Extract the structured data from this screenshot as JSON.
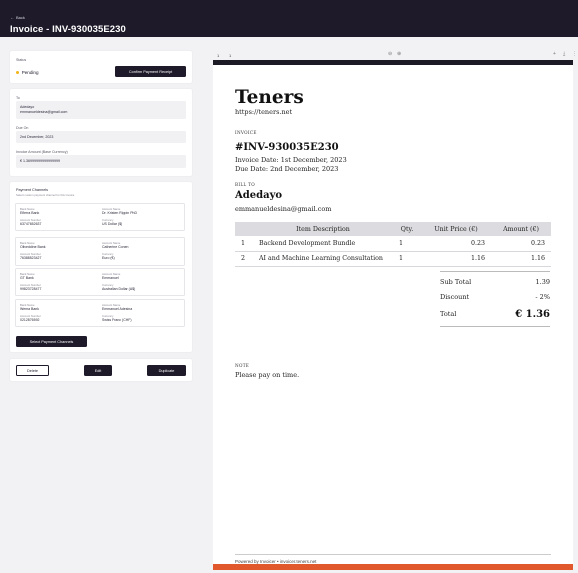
{
  "header": {
    "back_label": "Back",
    "title": "Invoice - INV-930035E230"
  },
  "status_card": {
    "label": "Status",
    "status": "Pending",
    "status_color": "#f2b517",
    "confirm_button": "Confirm Payment Receipt"
  },
  "details_card": {
    "to_label": "To",
    "to_name": "Adedayo",
    "to_email": "emmanueldesina@gmail.com",
    "due_label": "Due On",
    "due_value": "2nd December, 2023",
    "amount_label": "Invoice Amount (Base Currency)",
    "amount_value": "€ 1.36999999999999999"
  },
  "payment_channels": {
    "title": "Payment Channels",
    "subtitle": "Select custom payment channel for this invoice",
    "items": [
      {
        "bank_label": "Bank Name",
        "bank": "Eflerra Bank",
        "account_name_label": "Account Name",
        "account_name": "Dr. Kristen Rippin PhD",
        "account_number_label": "Account Number",
        "account_number": "63747652637",
        "currency_label": "Currency",
        "currency": "US Dollar ($)"
      },
      {
        "bank_label": "Bank Name",
        "bank": "Oliveddine Bank",
        "account_name_label": "Account Name",
        "account_name": "Catherine Conen",
        "account_number_label": "Account Number",
        "account_number": "76388523427",
        "currency_label": "Currency",
        "currency": "Euro (€)"
      },
      {
        "bank_label": "Bank Name",
        "bank": "GT Bank",
        "account_name_label": "Account Name",
        "account_name": "Emmanuel",
        "account_number_label": "Account Number",
        "account_number": "99823728477",
        "currency_label": "Currency",
        "currency": "Australian Dollar (A$)"
      },
      {
        "bank_label": "Bank Name",
        "bank": "Wema Bank",
        "account_name_label": "Account Name",
        "account_name": "Emmanuel Adesina",
        "account_number_label": "Account Number",
        "account_number": "0212876592",
        "currency_label": "Currency",
        "currency": "Swiss Franc (CHF)"
      }
    ],
    "select_button": "Select Payment Channels"
  },
  "actions": {
    "delete": "Delete",
    "edit": "Edit",
    "duplicate": "Duplicate"
  },
  "viewer": {
    "page_current": "1",
    "page_total": "1",
    "icons": [
      "zoom-out-icon",
      "zoom-in-icon",
      "plus-icon",
      "download-icon",
      "more-icon"
    ]
  },
  "invoice": {
    "company": "Teners",
    "company_url": "https://teners.net",
    "invoice_label": "INVOICE",
    "invoice_number": "#INV-930035E230",
    "invoice_date": "Invoice Date: 1st December, 2023",
    "due_date": "Due Date: 2nd December, 2023",
    "bill_to_label": "BILL TO",
    "client_name": "Adedayo",
    "client_email": "emmanueldesina@gmail.com",
    "table_headers": [
      "Item Description",
      "Qty.",
      "Unit Price (€)",
      "Amount (€)"
    ],
    "rows": [
      {
        "no": "1",
        "desc": "Backend Development Bundle",
        "qty": "1",
        "unit": "0.23",
        "amount": "0.23"
      },
      {
        "no": "2",
        "desc": "AI and Machine Learning Consultation",
        "qty": "1",
        "unit": "1.16",
        "amount": "1.16"
      }
    ],
    "subtotal_label": "Sub Total",
    "subtotal": "1.39",
    "discount_label": "Discount",
    "discount": "- 2%",
    "total_label": "Total",
    "total": "€ 1.36",
    "note_label": "NOTE",
    "note": "Please pay on time.",
    "footer": "Powered by Invoicer • invoicer.teners.net",
    "accent_color": "#e0582b"
  }
}
